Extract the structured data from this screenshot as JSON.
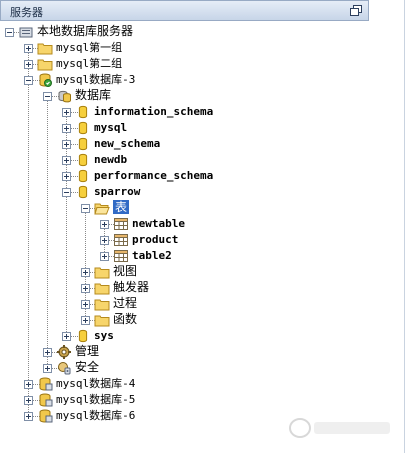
{
  "panel": {
    "title": "服务器"
  },
  "tree": [
    {
      "id": "root",
      "label": "本地数据库服务器",
      "depth": 0,
      "icon": "server-icon",
      "toggle": "minus",
      "cjk": true
    },
    {
      "id": "g1",
      "label": "mysql第一组",
      "depth": 1,
      "icon": "folder-icon",
      "toggle": "plus"
    },
    {
      "id": "g2",
      "label": "mysql第二组",
      "depth": 1,
      "icon": "folder-icon",
      "toggle": "plus"
    },
    {
      "id": "db3",
      "label": "mysql数据库-3",
      "depth": 1,
      "icon": "db-connected-icon",
      "toggle": "minus"
    },
    {
      "id": "dbs",
      "label": "数据库",
      "depth": 2,
      "icon": "database-group-icon",
      "toggle": "minus",
      "cjk": true
    },
    {
      "id": "s1",
      "label": "information_schema",
      "depth": 3,
      "icon": "schema-icon",
      "toggle": "plus",
      "bold": true
    },
    {
      "id": "s2",
      "label": "mysql",
      "depth": 3,
      "icon": "schema-icon",
      "toggle": "plus",
      "bold": true
    },
    {
      "id": "s3",
      "label": "new_schema",
      "depth": 3,
      "icon": "schema-icon",
      "toggle": "plus",
      "bold": true
    },
    {
      "id": "s4",
      "label": "newdb",
      "depth": 3,
      "icon": "schema-icon",
      "toggle": "plus",
      "bold": true
    },
    {
      "id": "s5",
      "label": "performance_schema",
      "depth": 3,
      "icon": "schema-icon",
      "toggle": "plus",
      "bold": true
    },
    {
      "id": "s6",
      "label": "sparrow",
      "depth": 3,
      "icon": "schema-icon",
      "toggle": "minus",
      "bold": true
    },
    {
      "id": "tbl",
      "label": "表",
      "depth": 4,
      "icon": "folder-open-icon",
      "toggle": "minus",
      "cjk": true,
      "selected": true
    },
    {
      "id": "t1",
      "label": "newtable",
      "depth": 5,
      "icon": "table-icon",
      "toggle": "plus",
      "bold": true
    },
    {
      "id": "t2",
      "label": "product",
      "depth": 5,
      "icon": "table-icon",
      "toggle": "plus",
      "bold": true
    },
    {
      "id": "t3",
      "label": "table2",
      "depth": 5,
      "icon": "table-icon",
      "toggle": "plus",
      "bold": true
    },
    {
      "id": "v",
      "label": "视图",
      "depth": 4,
      "icon": "folder-icon",
      "toggle": "plus",
      "cjk": true
    },
    {
      "id": "tr",
      "label": "触发器",
      "depth": 4,
      "icon": "folder-icon",
      "toggle": "plus",
      "cjk": true
    },
    {
      "id": "p",
      "label": "过程",
      "depth": 4,
      "icon": "folder-icon",
      "toggle": "plus",
      "cjk": true
    },
    {
      "id": "f",
      "label": "函数",
      "depth": 4,
      "icon": "folder-icon",
      "toggle": "plus",
      "cjk": true
    },
    {
      "id": "sys",
      "label": "sys",
      "depth": 3,
      "icon": "schema-icon",
      "toggle": "plus",
      "bold": true
    },
    {
      "id": "mg",
      "label": "管理",
      "depth": 2,
      "icon": "manage-icon",
      "toggle": "plus",
      "cjk": true
    },
    {
      "id": "sec",
      "label": "安全",
      "depth": 2,
      "icon": "security-icon",
      "toggle": "plus",
      "cjk": true
    },
    {
      "id": "db4",
      "label": "mysql数据库-4",
      "depth": 1,
      "icon": "db-icon",
      "toggle": "plus"
    },
    {
      "id": "db5",
      "label": "mysql数据库-5",
      "depth": 1,
      "icon": "db-icon",
      "toggle": "plus"
    },
    {
      "id": "db6",
      "label": "mysql数据库-6",
      "depth": 1,
      "icon": "db-icon",
      "toggle": "plus"
    }
  ]
}
